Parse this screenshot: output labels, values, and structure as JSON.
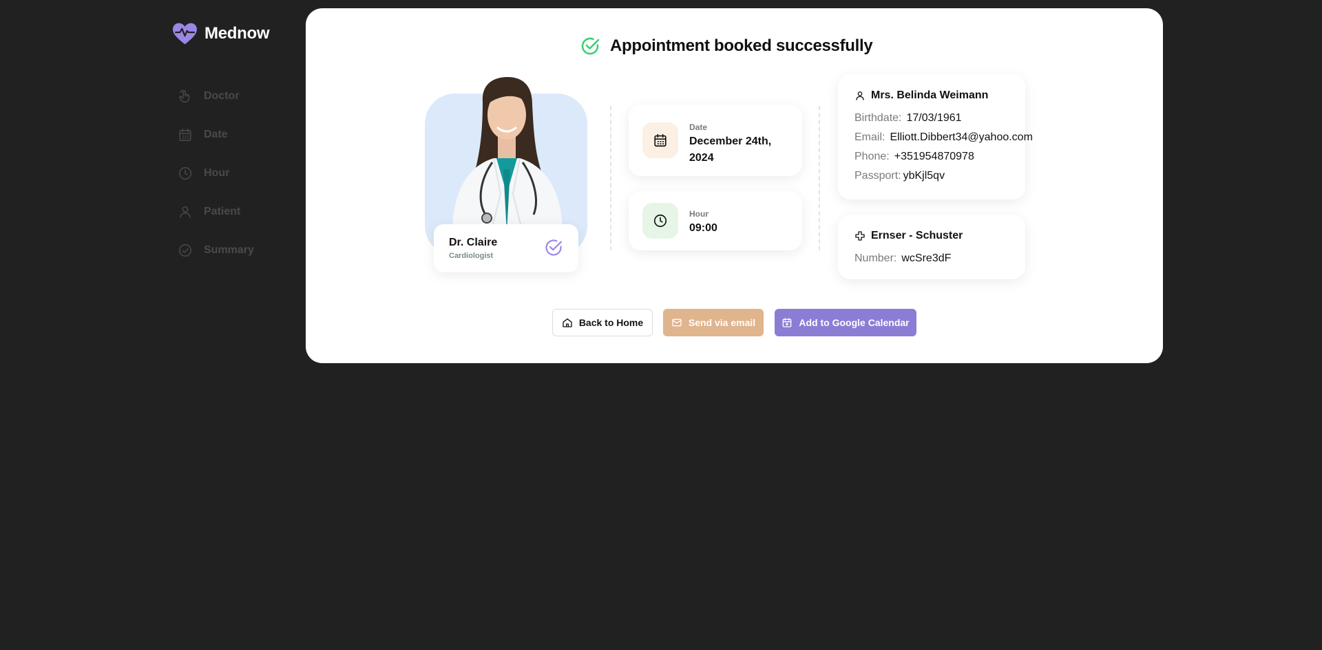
{
  "app": {
    "name": "Mednow",
    "logo_icon": "heart-pulse-icon"
  },
  "sidebar": {
    "items": [
      {
        "label": "Doctor",
        "icon": "hand-pointer-icon"
      },
      {
        "label": "Date",
        "icon": "calendar-icon"
      },
      {
        "label": "Hour",
        "icon": "clock-icon"
      },
      {
        "label": "Patient",
        "icon": "user-icon"
      },
      {
        "label": "Summary",
        "icon": "check-circle-icon"
      }
    ]
  },
  "summary": {
    "title": "Appointment booked successfully",
    "doctor": {
      "name": "Dr. Claire",
      "specialty": "Cardiologist"
    },
    "date": {
      "label": "Date",
      "value_line1": "December 24th,",
      "value_line2": "2024"
    },
    "hour": {
      "label": "Hour",
      "value": "09:00"
    },
    "patient": {
      "name": "Mrs. Belinda Weimann",
      "birthdate_label": "Birthdate:",
      "birthdate": "17/03/1961",
      "email_label": "Email:",
      "email": "Elliott.Dibbert34@yahoo.com",
      "phone_label": "Phone:",
      "phone": "+351954870978",
      "passport_label": "Passport:",
      "passport": "ybKjl5qv"
    },
    "insurance": {
      "name": "Ernser - Schuster",
      "number_label": "Number:",
      "number": "wcSre3dF"
    }
  },
  "actions": {
    "home": "Back to Home",
    "email": "Send via email",
    "calendar": "Add to Google Calendar"
  },
  "colors": {
    "background": "#212121",
    "brand": "#9b86e6",
    "success": "#3ccf75",
    "email_button": "#e0b48d",
    "calendar_button": "#8c7dd4",
    "date_tile": "#fcefe3",
    "hour_tile": "#e6f5e6",
    "doctor_bg": "#dbe9fa"
  }
}
